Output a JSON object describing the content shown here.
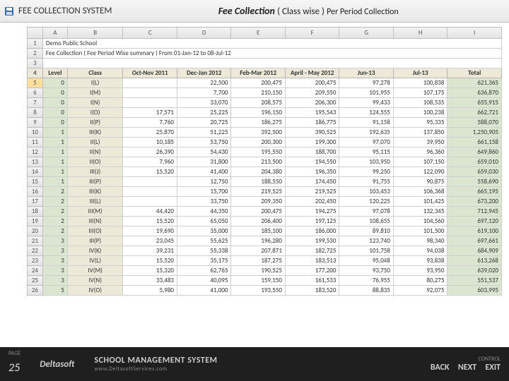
{
  "header": {
    "app_title": "FEE COLLECTION SYSTEM",
    "page_title_main": "Fee Collection",
    "page_title_sub": "( Class wise )",
    "page_title_sub2": "Per Period Collection"
  },
  "sheet": {
    "cols": [
      "A",
      "B",
      "C",
      "D",
      "E",
      "F",
      "G",
      "H",
      "I"
    ],
    "meta": {
      "school": "Demo Public School",
      "report": "Fee Collection ( Fee Period Wise summary ) From 01-Jan-12 to 08-Jul-12"
    },
    "hdr": {
      "level": "Level",
      "class": "Class",
      "p0": "Oct-Nov 2011",
      "p1": "Dec-Jan 2012",
      "p2": "Feb-Mar 2012",
      "p3": "April - May 2012",
      "p4": "Jun-13",
      "p5": "Jul-13",
      "total": "Total"
    },
    "rows": [
      {
        "lvl": "0",
        "cls": "I(L)",
        "v": [
          "",
          "22,500",
          "200,475",
          "200,475",
          "97,278",
          "100,838",
          "621,365"
        ]
      },
      {
        "lvl": "0",
        "cls": "I(M)",
        "v": [
          "",
          "7,700",
          "210,150",
          "209,550",
          "101,955",
          "107,175",
          "636,870"
        ]
      },
      {
        "lvl": "0",
        "cls": "I(N)",
        "v": [
          "",
          "33,070",
          "208,575",
          "206,300",
          "99,433",
          "108,535",
          "655,915"
        ]
      },
      {
        "lvl": "0",
        "cls": "I(O)",
        "v": [
          "17,571",
          "25,225",
          "196,150",
          "195,543",
          "124,555",
          "100,238",
          "662,721"
        ]
      },
      {
        "lvl": "0",
        "cls": "II(P)",
        "v": [
          "7,760",
          "20,725",
          "186,275",
          "186,775",
          "91,158",
          "95,335",
          "588,070"
        ]
      },
      {
        "lvl": "1",
        "cls": "III(K)",
        "v": [
          "25,870",
          "51,225",
          "392,500",
          "390,525",
          "192,635",
          "137,850",
          "1,250,905"
        ]
      },
      {
        "lvl": "1",
        "cls": "II(L)",
        "v": [
          "10,185",
          "53,750",
          "200,300",
          "199,300",
          "97,070",
          "39,950",
          "661,158"
        ]
      },
      {
        "lvl": "1",
        "cls": "II(N)",
        "v": [
          "26,390",
          "54,430",
          "195,550",
          "188,700",
          "95,115",
          "96,360",
          "649,860"
        ]
      },
      {
        "lvl": "1",
        "cls": "II(O)",
        "v": [
          "7,960",
          "31,800",
          "213,500",
          "194,550",
          "103,950",
          "107,150",
          "659,010"
        ]
      },
      {
        "lvl": "1",
        "cls": "III(J)",
        "v": [
          "15,520",
          "41,400",
          "204,380",
          "196,350",
          "99,250",
          "122,090",
          "659,030"
        ]
      },
      {
        "lvl": "1",
        "cls": "III(P)",
        "v": [
          "",
          "12,750",
          "188,550",
          "174,450",
          "91,755",
          "90,875",
          "558,690"
        ]
      },
      {
        "lvl": "2",
        "cls": "III(K)",
        "v": [
          "",
          "15,700",
          "219,525",
          "219,525",
          "103,453",
          "106,368",
          "665,195"
        ]
      },
      {
        "lvl": "2",
        "cls": "III(L)",
        "v": [
          "",
          "33,750",
          "209,350",
          "202,450",
          "120,225",
          "101,425",
          "673,200"
        ]
      },
      {
        "lvl": "2",
        "cls": "III(M)",
        "v": [
          "44,420",
          "44,350",
          "200,475",
          "194,275",
          "97,078",
          "132,345",
          "712,945"
        ]
      },
      {
        "lvl": "2",
        "cls": "III(N)",
        "v": [
          "15,520",
          "65,050",
          "206,400",
          "197,125",
          "108,655",
          "104,560",
          "697,120"
        ]
      },
      {
        "lvl": "2",
        "cls": "III(O)",
        "v": [
          "19,690",
          "35,000",
          "185,100",
          "186,000",
          "89,810",
          "101,500",
          "619,100"
        ]
      },
      {
        "lvl": "3",
        "cls": "III(P)",
        "v": [
          "23,045",
          "55,625",
          "196,280",
          "199,530",
          "123,740",
          "98,340",
          "697,661"
        ]
      },
      {
        "lvl": "3",
        "cls": "IV(K)",
        "v": [
          "39,231",
          "55,338",
          "207,871",
          "182,725",
          "101,758",
          "94,038",
          "684,909"
        ]
      },
      {
        "lvl": "3",
        "cls": "IV(L)",
        "v": [
          "15,520",
          "35,175",
          "187,275",
          "183,513",
          "95,048",
          "93,838",
          "613,268"
        ]
      },
      {
        "lvl": "3",
        "cls": "IV(M)",
        "v": [
          "15,320",
          "62,765",
          "190,525",
          "177,200",
          "93,750",
          "93,950",
          "639,020"
        ]
      },
      {
        "lvl": "3",
        "cls": "IV(N)",
        "v": [
          "33,483",
          "40,095",
          "159,150",
          "161,533",
          "76,955",
          "80,275",
          "551,537"
        ]
      },
      {
        "lvl": "5",
        "cls": "IV(O)",
        "v": [
          "5,980",
          "41,000",
          "193,550",
          "183,520",
          "88,835",
          "92,075",
          "603,995"
        ]
      }
    ]
  },
  "footer": {
    "page_label": "PAGE",
    "page_num": "25",
    "brand": "Deltasoft",
    "sms": "SCHOOL MANAGEMENT SYSTEM",
    "url": "www.DeltasoftServices.com",
    "control_label": "CONTROL",
    "back": "BACK",
    "next": "NEXT",
    "exit": "EXIT"
  }
}
